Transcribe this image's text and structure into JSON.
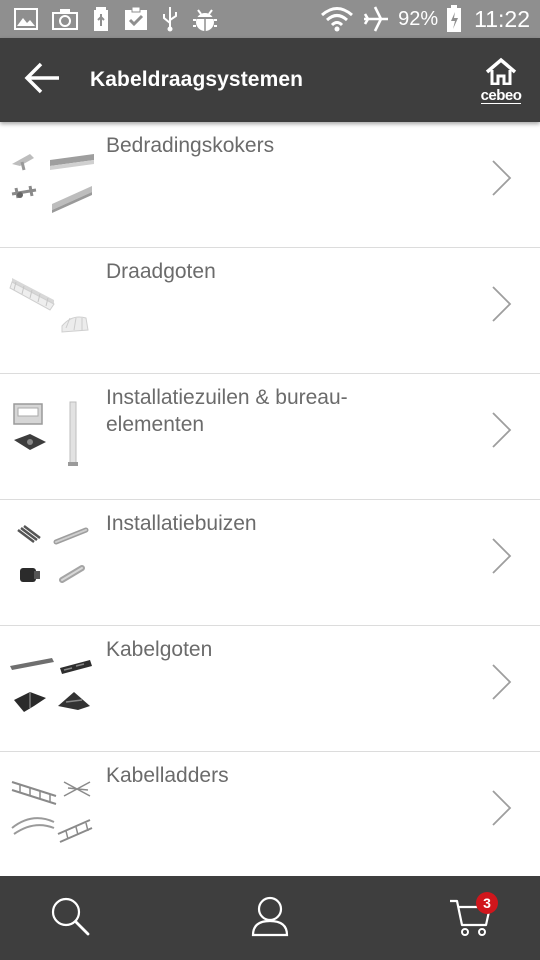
{
  "status_bar": {
    "battery": "92%",
    "time": "11:22"
  },
  "app_bar": {
    "title": "Kabeldraagsystemen",
    "brand": "cebeo"
  },
  "categories": [
    {
      "label": "Bedradingskokers"
    },
    {
      "label": "Draadgoten"
    },
    {
      "label": "Installatiezuilen & bureau-elementen"
    },
    {
      "label": "Installatiebuizen"
    },
    {
      "label": "Kabelgoten"
    },
    {
      "label": "Kabelladders"
    }
  ],
  "bottom_nav": {
    "cart_count": "3"
  },
  "colors": {
    "status_bar": "#8f8f8f",
    "app_bar": "#3e3e3e",
    "badge": "#d0161c",
    "label_text": "#6b6b6b"
  }
}
